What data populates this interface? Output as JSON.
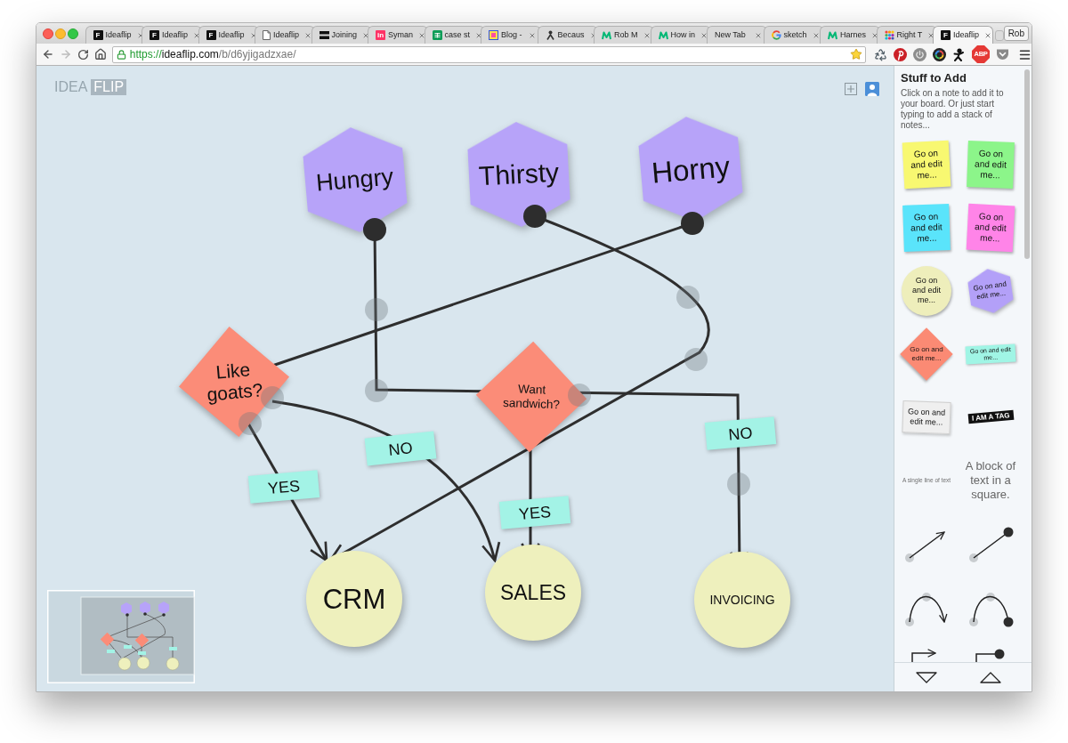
{
  "browser": {
    "tabs": [
      {
        "title": "Ideaflip",
        "selected": false,
        "kind": "letter",
        "icon_text": "F",
        "color": "#111111"
      },
      {
        "title": "Ideaflip",
        "selected": false,
        "kind": "letter",
        "icon_text": "F",
        "color": "#111111"
      },
      {
        "title": "Ideaflip",
        "selected": false,
        "kind": "letter",
        "icon_text": "F",
        "color": "#111111"
      },
      {
        "title": "Ideaflip",
        "selected": false,
        "kind": "page"
      },
      {
        "title": "Joining",
        "selected": false,
        "kind": "stamp"
      },
      {
        "title": "Syman",
        "selected": false,
        "kind": "letter",
        "icon_text": "in",
        "color": "#ff3366"
      },
      {
        "title": "case st",
        "selected": false,
        "kind": "sheet"
      },
      {
        "title": "Blog -",
        "selected": false,
        "kind": "frame"
      },
      {
        "title": "Becaus",
        "selected": false,
        "kind": "figure"
      },
      {
        "title": "Rob M",
        "selected": false,
        "kind": "medium"
      },
      {
        "title": "How in",
        "selected": false,
        "kind": "medium"
      },
      {
        "title": "New Tab",
        "selected": false,
        "kind": "blank"
      },
      {
        "title": "sketch",
        "selected": false,
        "kind": "google"
      },
      {
        "title": "Harnes",
        "selected": false,
        "kind": "medium"
      },
      {
        "title": "Right T",
        "selected": false,
        "kind": "grid"
      },
      {
        "title": "Ideaflip",
        "selected": true,
        "kind": "letter",
        "icon_text": "F",
        "color": "#111111"
      }
    ],
    "profile": "Rob",
    "url": {
      "scheme": "https://",
      "host": "ideaflip.com",
      "path": "/b/d6yjigadzxae/"
    },
    "bookmarked": true,
    "adblock_label": "ABP"
  },
  "logo": {
    "word_1": "IDEA",
    "word_2": "FLIP"
  },
  "board": {
    "nodes": [
      {
        "kind": "hexagon",
        "text": "Hungry"
      },
      {
        "kind": "hexagon",
        "text": "Thirsty"
      },
      {
        "kind": "hexagon",
        "text": "Horny"
      },
      {
        "kind": "diamond",
        "text": "Like goats?"
      },
      {
        "kind": "diamond",
        "text": "Want sandwich?"
      },
      {
        "kind": "tag",
        "text": "NO"
      },
      {
        "kind": "tag",
        "text": "NO"
      },
      {
        "kind": "tag",
        "text": "YES"
      },
      {
        "kind": "tag",
        "text": "YES"
      },
      {
        "kind": "circle",
        "text": "CRM"
      },
      {
        "kind": "circle",
        "text": "SALES"
      },
      {
        "kind": "circle",
        "text": "INVOICING"
      }
    ]
  },
  "sidebar": {
    "title": "Stuff to Add",
    "description": "Click on a note to add it to your board. Or just start typing to add a stack of notes...",
    "items": [
      {
        "kind": "note",
        "color": "#f8f871",
        "text": "Go on and edit me..."
      },
      {
        "kind": "note",
        "color": "#8cf58a",
        "text": "Go on and edit me..."
      },
      {
        "kind": "note",
        "color": "#5ae4fb",
        "text": "Go on and edit me..."
      },
      {
        "kind": "note",
        "color": "#ff84e8",
        "text": "Go on and edit me..."
      },
      {
        "kind": "circle",
        "color": "#eeeebb",
        "text": "Go on and edit me..."
      },
      {
        "kind": "hexagon",
        "color": "#b3a0f8",
        "text": "Go on and edit me..."
      },
      {
        "kind": "diamond",
        "color": "#fb8a74",
        "text": "Go on and edit me..."
      },
      {
        "kind": "tag",
        "color": "#a0f5e5",
        "text": "Go on and edit me..."
      },
      {
        "kind": "card",
        "text": "Go on and edit me..."
      },
      {
        "kind": "label",
        "text": "I AM A TAG"
      },
      {
        "kind": "line_text",
        "text": "A single line of text"
      },
      {
        "kind": "text_block",
        "text": "A block of text in a square."
      },
      {
        "kind": "straight_arrow"
      },
      {
        "kind": "straight_dot"
      },
      {
        "kind": "curve_arrow"
      },
      {
        "kind": "curve_dot"
      },
      {
        "kind": "elbow_arrow"
      },
      {
        "kind": "elbow_dot"
      }
    ]
  }
}
